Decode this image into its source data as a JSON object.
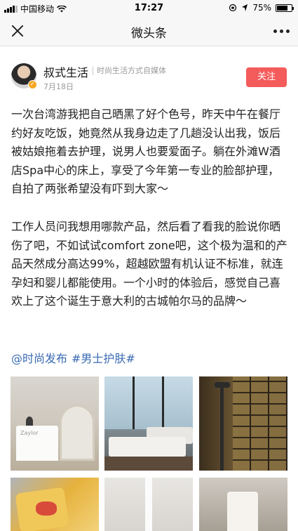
{
  "status_bar": {
    "carrier": "中国移动",
    "time": "17:27",
    "battery_text": "75%",
    "battery_level": 0.75
  },
  "nav": {
    "title": "微头条"
  },
  "author": {
    "name": "叔式生活",
    "description": "时尚生活方式自媒体",
    "date": "7月18日",
    "follow_label": "关注"
  },
  "article": {
    "paragraph1": "一次台湾游我把自己晒黑了好个色号，昨天中午在餐厅约好友吃饭，她竟然从我身边走了几趟没认出我，饭后被姑娘拖着去护理，说男人也要爱面子。躺在外滩W酒店Spa中心的床上，享受了今年第一专业的脸部护理，自拍了两张希望没有吓到大家～",
    "paragraph2": "工作人员问我想用哪款产品，然后看了看我的脸说你晒伤了吧，不如试试comfort zone吧，这个极为温和的产品天然成分高达99%，超越欧盟有机认证不标准，就连孕妇和婴儿都能使用。一个小时的体验后，感觉自己喜欢上了这个诞生于意大利的古城帕尔马的品牌～",
    "tags": [
      "@时尚发布",
      "#男士护肤#"
    ]
  },
  "photo1": {
    "counter_logo": "Zaylor"
  },
  "colors": {
    "follow_button": "#f45b5b",
    "tag_link": "#3a6bb3",
    "verified_badge": "#f5a623"
  }
}
